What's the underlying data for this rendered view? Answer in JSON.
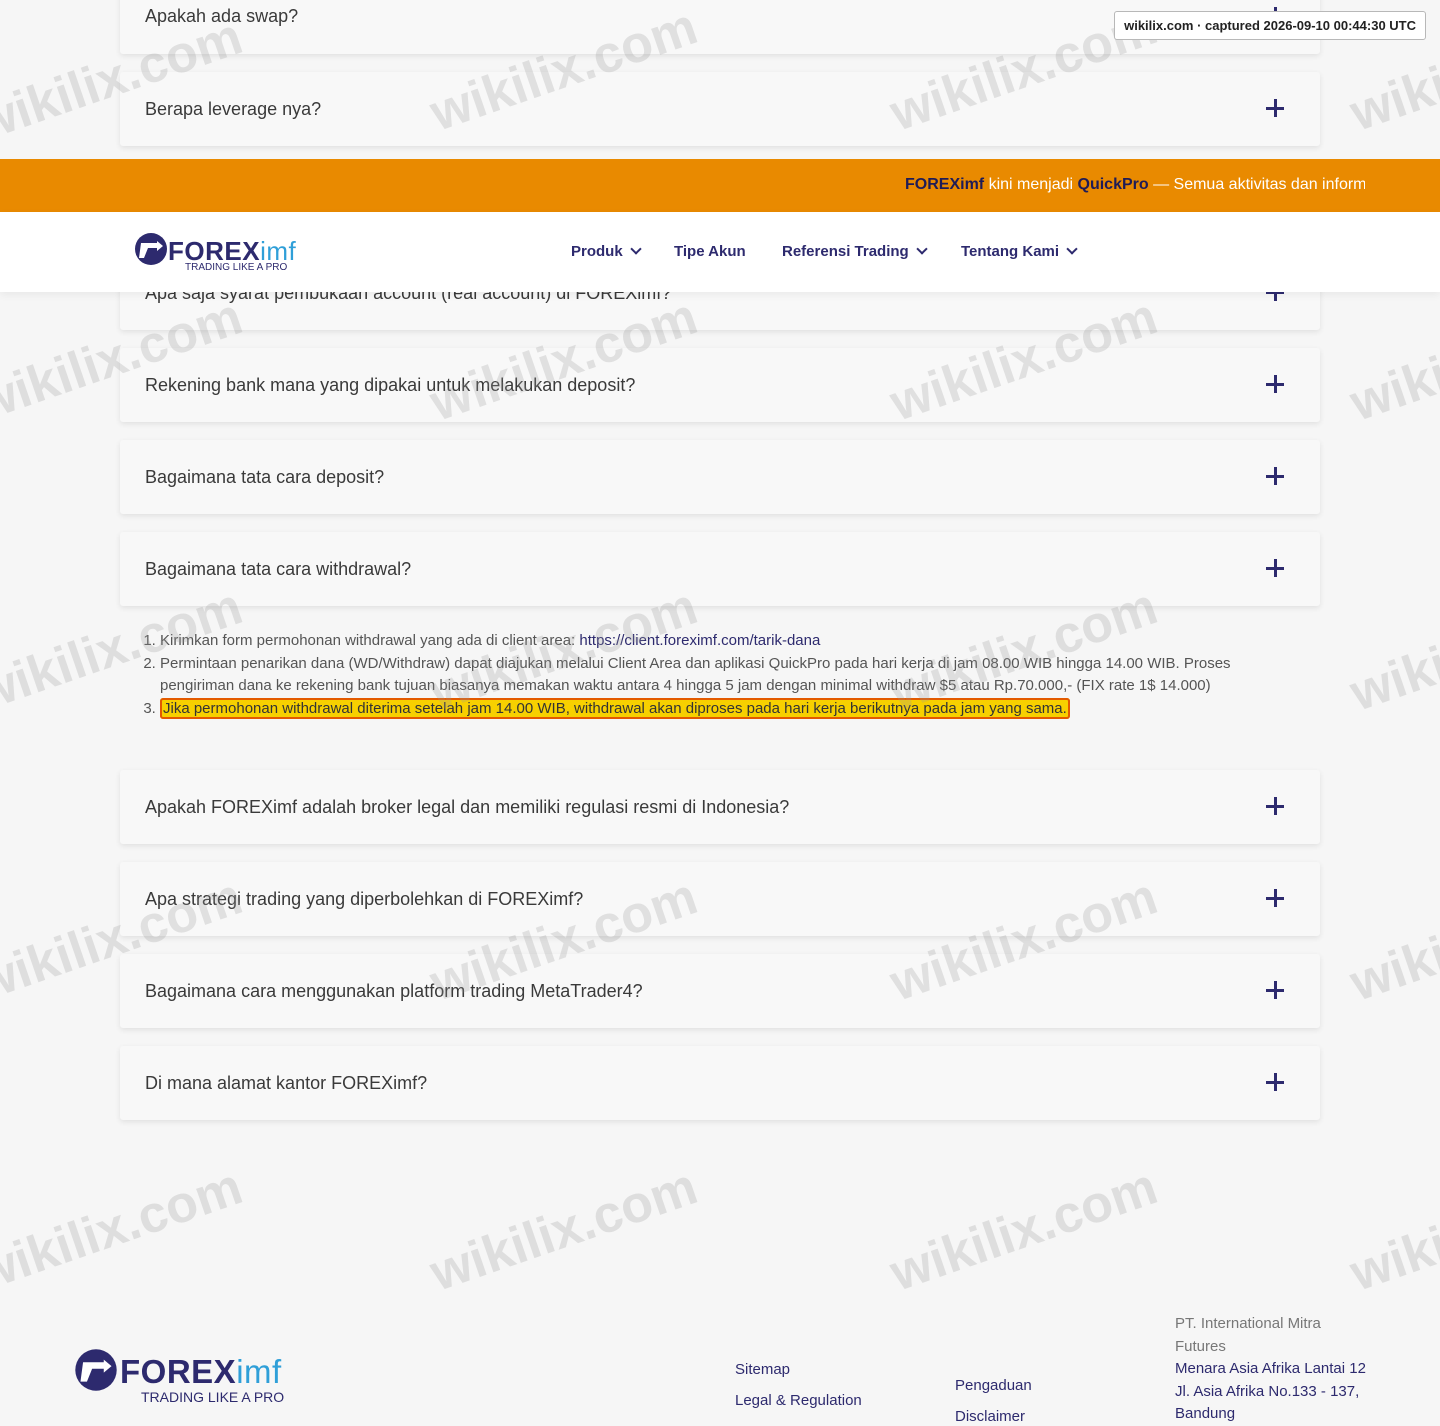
{
  "capture_stamp": "wikilix.com · captured 2026-09-10 00:44:30 UTC",
  "watermark": "wikilix.com",
  "brand": {
    "name_bold": "FOREX",
    "name_light": "imf",
    "tagline": "TRADING LIKE A PRO",
    "primary_color": "#2d2a6e",
    "accent_color": "#2f9fd8",
    "banner_color": "#e98a00"
  },
  "banner": {
    "part1": "FOREXimf",
    "part2": " kini menjadi ",
    "part3": "QuickPro",
    "part4": " — Semua aktivitas dan inform"
  },
  "nav": {
    "produk": "Produk",
    "tipe_akun": "Tipe Akun",
    "referensi": "Referensi Trading",
    "tentang": "Tentang Kami"
  },
  "faq": [
    "Apakah ada swap?",
    "Berapa leverage nya?",
    "Apa saja syarat pembukaan account (real account) di FOREXimf?",
    "Rekening bank mana yang dipakai untuk melakukan deposit?",
    "Bagaimana tata cara deposit?",
    "Bagaimana tata cara withdrawal?",
    "Apakah FOREXimf adalah broker legal dan memiliki regulasi resmi di Indonesia?",
    "Apa strategi trading yang diperbolehkan di FOREXimf?",
    "Bagaimana cara menggunakan platform trading MetaTrader4?",
    "Di mana alamat kantor FOREXimf?"
  ],
  "withdrawal_answer": {
    "item1_text": "Kirimkan form permohonan withdrawal yang ada di client area: ",
    "item1_link": "https://client.foreximf.com/tarik-dana",
    "item2": "Permintaan penarikan dana (WD/Withdraw) dapat diajukan melalui Client Area dan aplikasi QuickPro pada hari kerja di jam 08.00 WIB hingga 14.00 WIB. Proses pengiriman dana ke rekening bank tujuan biasanya memakan waktu antara 4 hingga 5 jam dengan minimal withdraw $5 atau Rp.70.000,-  (FIX rate 1$ 14.000)",
    "item3": "Jika permohonan withdrawal diterima setelah jam 14.00 WIB, withdrawal akan diproses pada hari kerja berikutnya pada jam yang sama."
  },
  "footer": {
    "sitemap": "Sitemap",
    "legal": "Legal & Regulation",
    "pengaduan": "Pengaduan",
    "disclaimer": "Disclaimer",
    "company_name": "PT. International Mitra Futures",
    "company_address": "Menara Asia Afrika Lantai 12 Jl. Asia Afrika No.133 - 137, Bandung"
  }
}
